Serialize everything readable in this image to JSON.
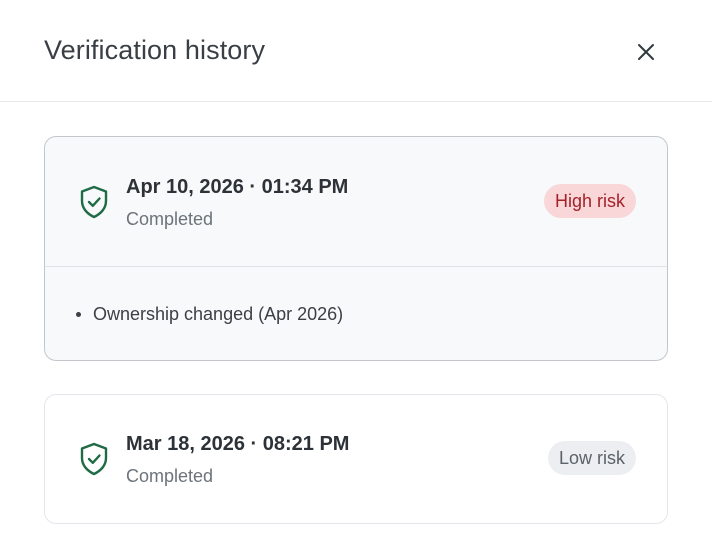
{
  "header": {
    "title": "Verification history",
    "close_icon": "close-icon"
  },
  "colors": {
    "shield": "#1e6b45",
    "high_risk_bg": "#f9d7d8",
    "high_risk_text": "#a3222a",
    "low_risk_bg": "#eceef1",
    "low_risk_text": "#5b626a"
  },
  "entries": [
    {
      "icon": "shield-check-icon",
      "datetime": "Apr 10, 2026 · 01:34 PM",
      "status": "Completed",
      "risk": "High risk",
      "expanded": true,
      "details": [
        "Ownership changed (Apr 2026)"
      ]
    },
    {
      "icon": "shield-check-icon",
      "datetime": "Mar 18, 2026 · 08:21 PM",
      "status": "Completed",
      "risk": "Low risk",
      "expanded": false,
      "details": []
    }
  ]
}
